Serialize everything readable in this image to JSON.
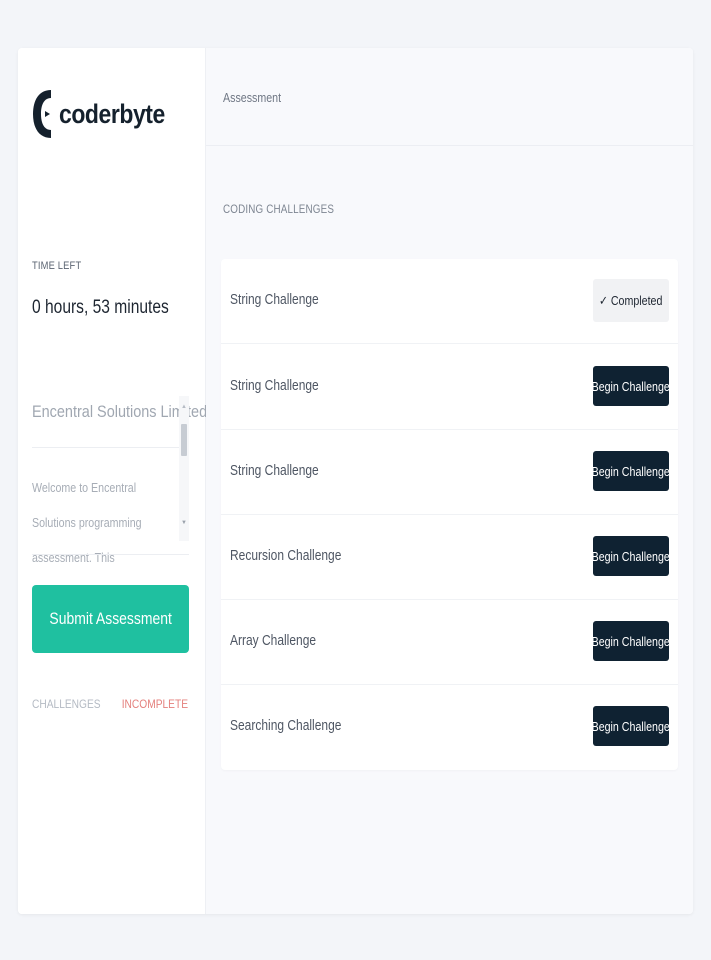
{
  "brand": {
    "name": "coderbyte",
    "color": "#15212d"
  },
  "sidebar": {
    "time_left_label": "TIME LEFT",
    "time_left_value": "0 hours, 53 minutes",
    "company_name": "Encentral Solutions Limited",
    "welcome_text": "Welcome to Encentral Solutions programming assessment. This",
    "submit_label": "Submit Assessment",
    "challenges_label": "CHALLENGES",
    "status_label": "INCOMPLETE"
  },
  "header": {
    "title": "Assessment"
  },
  "main": {
    "section_title": "CODING CHALLENGES",
    "challenges": [
      {
        "name": "String Challenge",
        "action": "✓ Completed",
        "completed": true
      },
      {
        "name": "String Challenge",
        "action": "Begin Challenge",
        "completed": false
      },
      {
        "name": "String Challenge",
        "action": "Begin Challenge",
        "completed": false
      },
      {
        "name": "Recursion Challenge",
        "action": "Begin Challenge",
        "completed": false
      },
      {
        "name": "Array Challenge",
        "action": "Begin Challenge",
        "completed": false
      },
      {
        "name": "Searching Challenge",
        "action": "Begin Challenge",
        "completed": false
      }
    ]
  },
  "colors": {
    "accent": "#1fc0a0",
    "dark_button": "#0f2232",
    "incomplete": "#e4807d",
    "background": "#f3f5f9"
  },
  "icons": {
    "logo": "coderbyte-logo-icon",
    "completed": "check-icon",
    "scroll_up": "chevron-up-icon",
    "scroll_down": "chevron-down-icon"
  }
}
